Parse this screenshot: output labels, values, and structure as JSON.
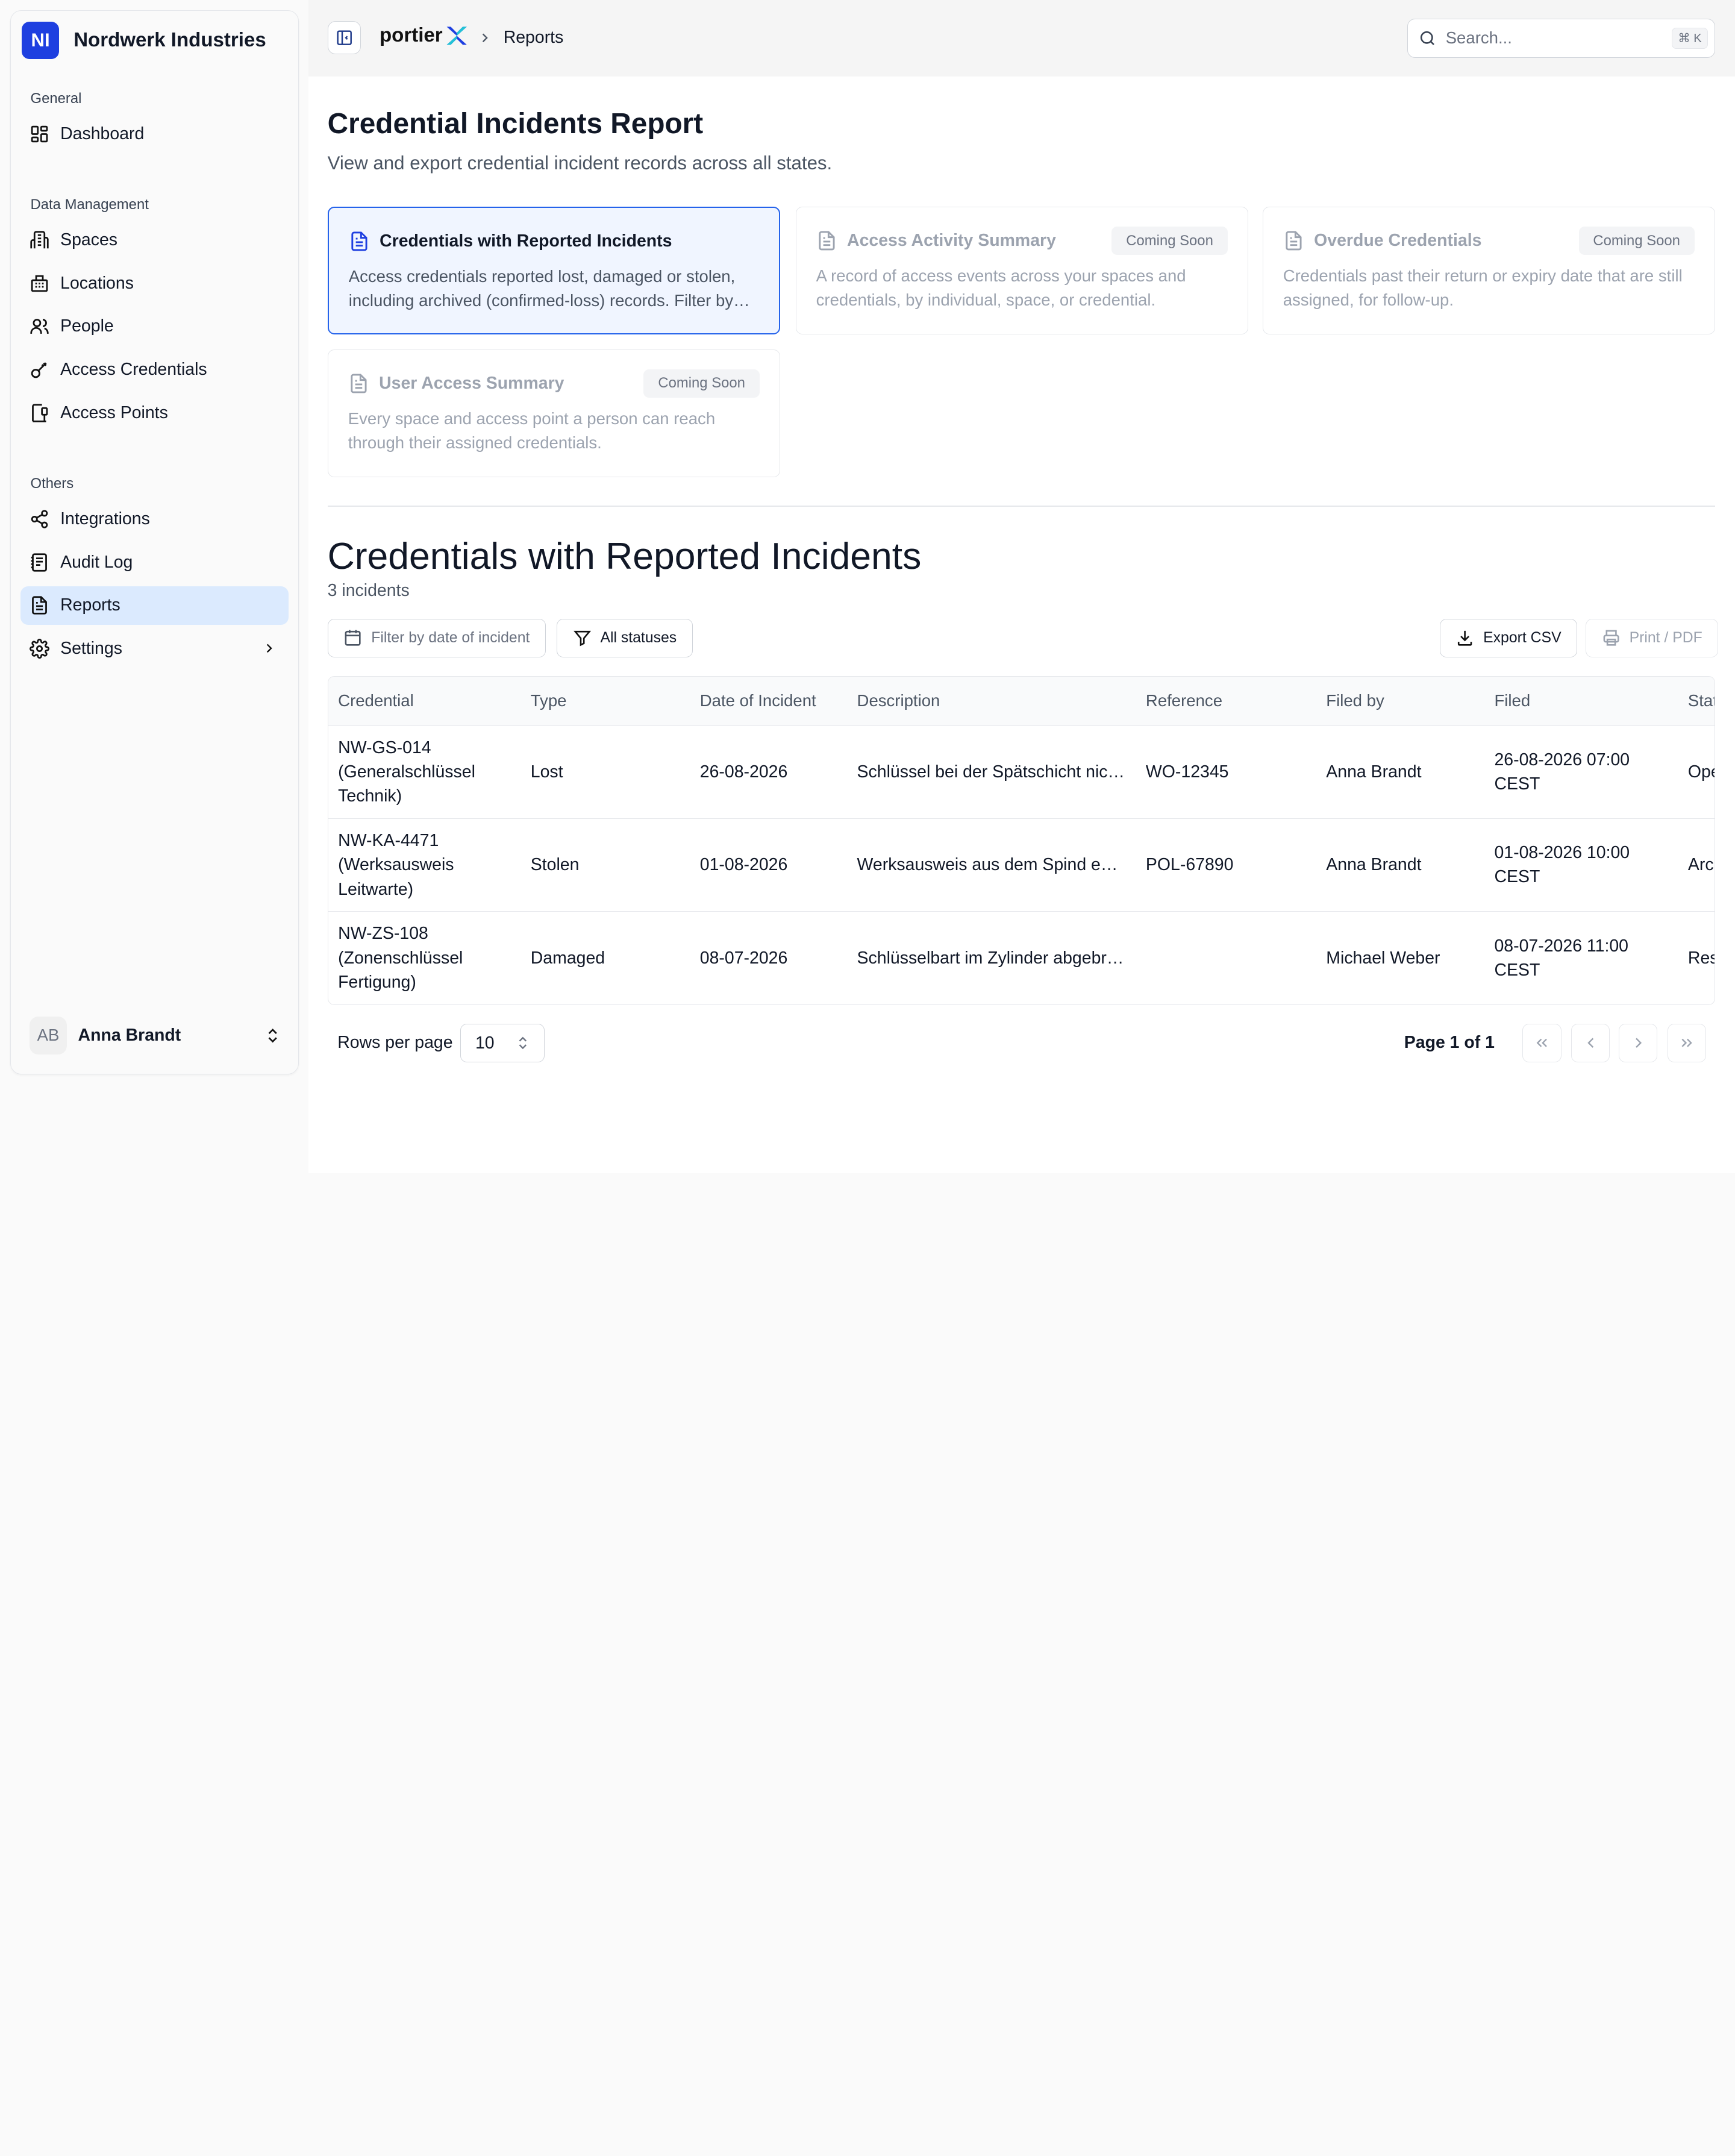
{
  "org": {
    "initials": "NI",
    "name": "Nordwerk Industries"
  },
  "sidebar": {
    "general_heading": "General",
    "general_items": [
      {
        "label": "Dashboard",
        "icon": "dashboard-icon"
      }
    ],
    "data_heading": "Data Management",
    "data_items": [
      {
        "label": "Spaces",
        "icon": "building-icon"
      },
      {
        "label": "Locations",
        "icon": "buildings-icon"
      },
      {
        "label": "People",
        "icon": "users-icon"
      },
      {
        "label": "Access Credentials",
        "icon": "key-icon"
      },
      {
        "label": "Access Points",
        "icon": "door-icon"
      }
    ],
    "others_heading": "Others",
    "others_items": [
      {
        "label": "Integrations",
        "icon": "share-icon"
      },
      {
        "label": "Audit Log",
        "icon": "log-icon"
      },
      {
        "label": "Reports",
        "icon": "report-icon",
        "active": true
      },
      {
        "label": "Settings",
        "icon": "gear-icon"
      }
    ]
  },
  "user": {
    "initials": "AB",
    "name": "Anna Brandt"
  },
  "header": {
    "brand": "portier",
    "breadcrumb": "Reports",
    "search_placeholder": "Search...",
    "search_shortcut": "⌘ K"
  },
  "page": {
    "title": "Credential Incidents Report",
    "subtitle": "View and export credential incident records across all states."
  },
  "report_cards": [
    {
      "title": "Credentials with Reported Incidents",
      "desc": "Access credentials reported lost, damaged or stolen, including archived (confirmed-loss) records. Filter by date of incident or status.",
      "badge": ""
    },
    {
      "title": "Access Activity Summary",
      "desc": "A record of access events across your spaces and credentials, by individual, space, or credential.",
      "badge": "Coming Soon"
    },
    {
      "title": "Overdue Credentials",
      "desc": "Credentials past their return or expiry date that are still assigned, for follow-up.",
      "badge": "Coming Soon"
    },
    {
      "title": "User Access Summary",
      "desc": "Every space and access point a person can reach through their assigned credentials.",
      "badge": "Coming Soon"
    }
  ],
  "report": {
    "title": "Credentials with Reported Incidents",
    "count": "3 incidents",
    "filter_date_label": "Filter by date of incident",
    "filter_status_label": "All statuses",
    "export_label": "Export CSV",
    "print_label": "Print / PDF"
  },
  "table": {
    "columns": [
      "Credential",
      "Type",
      "Date of Incident",
      "Description",
      "Reference",
      "Filed by",
      "Filed",
      "Status"
    ],
    "rows": [
      {
        "credential": "NW-GS-014 (Generalschlüssel Technik)",
        "type": "Lost",
        "date": "26-08-2026",
        "desc": "Schlüssel bei der Spätschicht nicht zurückgegeben",
        "ref": "WO-12345",
        "filed_by": "Anna Brandt",
        "filed": "26-08-2026 07:00 CEST",
        "status": "Open"
      },
      {
        "credential": "NW-KA-4471 (Werksausweis Leitwarte)",
        "type": "Stolen",
        "date": "01-08-2026",
        "desc": "Werksausweis aus dem Spind entwendet",
        "ref": "POL-67890",
        "filed_by": "Anna Brandt",
        "filed": "01-08-2026 10:00 CEST",
        "status": "Archived"
      },
      {
        "credential": "NW-ZS-108 (Zonenschlüssel Fertigung)",
        "type": "Damaged",
        "date": "08-07-2026",
        "desc": "Schlüsselbart im Zylinder abgebrochen",
        "ref": "",
        "filed_by": "Michael Weber",
        "filed": "08-07-2026 11:00 CEST",
        "status": "Resolved"
      }
    ]
  },
  "pagination": {
    "rows_label": "Rows per page",
    "rows_value": "10",
    "page_info": "Page 1 of 1"
  },
  "colors": {
    "accent": "#1e3fe0",
    "active_nav": "#dbeafe",
    "card_active_border": "#2563eb"
  }
}
